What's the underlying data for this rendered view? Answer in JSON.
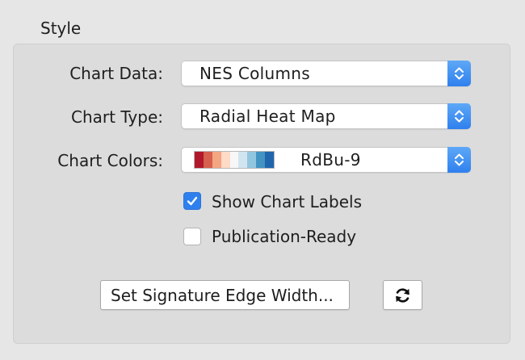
{
  "section_title": "Style",
  "chart_data_row": {
    "label": "Chart Data:",
    "value": "NES Columns"
  },
  "chart_type_row": {
    "label": "Chart Type:",
    "value": "Radial Heat Map"
  },
  "chart_colors_row": {
    "label": "Chart Colors:",
    "value": "RdBu-9",
    "palette": [
      "#b2182b",
      "#d6604d",
      "#f4a582",
      "#fddbc7",
      "#f7f7f7",
      "#d1e5f0",
      "#92c5de",
      "#4393c3",
      "#2166ac"
    ]
  },
  "show_chart_labels": {
    "label": "Show Chart Labels",
    "checked": true
  },
  "publication_ready": {
    "label": "Publication-Ready",
    "checked": false
  },
  "set_edge_width_button": {
    "label": "Set Signature Edge Width..."
  },
  "refresh_button": {
    "icon": "refresh-icon"
  },
  "colors": {
    "accent": "#2f80ee",
    "panel": "#dcdcdc",
    "background": "#e6e6e6"
  }
}
